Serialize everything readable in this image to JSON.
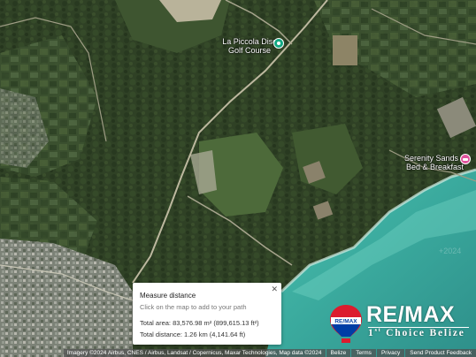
{
  "map": {
    "imagery": "satellite",
    "colors": {
      "forest": "#2e3f24",
      "forest_light": "#44592f",
      "sea": "#3fb6a6",
      "road": "#b8b59e",
      "town": "#8d8f86"
    },
    "faint_watermark": "+2024"
  },
  "places": [
    {
      "name": "La Piccola Disc Golf Course",
      "line1": "La Piccola Disc",
      "line2": "Golf Course",
      "icon": "golf-pin-icon"
    },
    {
      "name": "Serenity Sands Bed & Breakfast",
      "line1": "Serenity Sands",
      "line2": "Bed & Breakfast",
      "icon": "bed-icon"
    }
  ],
  "measure": {
    "title": "Measure distance",
    "hint": "Click on the map to add to your path",
    "area": "Total area: 83,576.98 m² (899,615.13 ft²)",
    "distance": "Total distance: 1.26 km (4,141.64 ft)",
    "close": "✕"
  },
  "attribution": {
    "credits": "Imagery ©2024 Airbus, CNES / Airbus, Landsat / Copernicus, Maxar Technologies, Map data ©2024",
    "links": [
      "Belize",
      "Terms",
      "Privacy",
      "Send Product Feedback"
    ]
  },
  "branding": {
    "wordmark": "RE/MAX",
    "balloon_text": "RE/MAX",
    "ordinal": "st",
    "subtitle_pre": "1",
    "subtitle_post": " Choice Belize",
    "colors": {
      "red": "#dc1c2e",
      "blue": "#003da5",
      "white": "#ffffff"
    }
  }
}
